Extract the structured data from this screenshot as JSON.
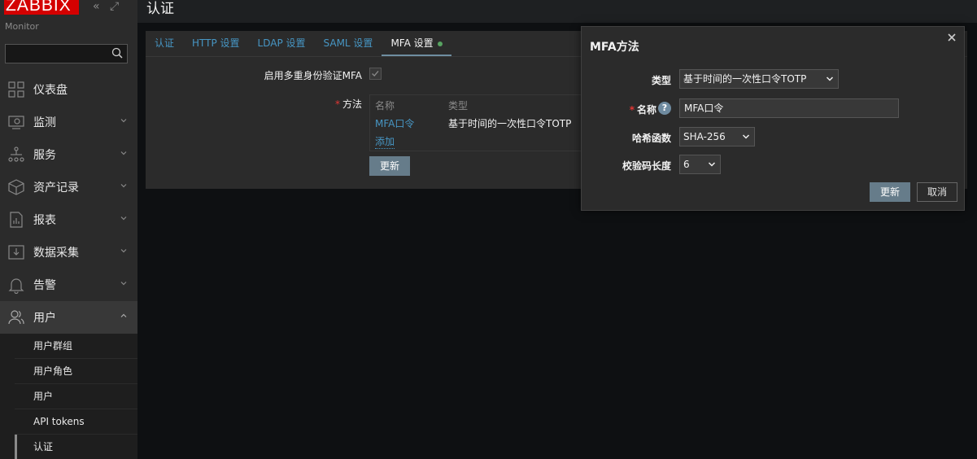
{
  "sidebar": {
    "logo": "ZABBIX",
    "server_name": "Monitor",
    "search_placeholder": "",
    "menu": [
      {
        "label": "仪表盘",
        "icon": "dashboard-icon"
      },
      {
        "label": "监测",
        "icon": "monitoring-icon"
      },
      {
        "label": "服务",
        "icon": "services-icon"
      },
      {
        "label": "资产记录",
        "icon": "inventory-icon"
      },
      {
        "label": "报表",
        "icon": "reports-icon"
      },
      {
        "label": "数据采集",
        "icon": "data-collection-icon"
      },
      {
        "label": "告警",
        "icon": "alerts-icon"
      },
      {
        "label": "用户",
        "icon": "users-icon"
      }
    ],
    "submenu": [
      "用户群组",
      "用户角色",
      "用户",
      "API tokens",
      "认证"
    ]
  },
  "page": {
    "title": "认证",
    "tabs": [
      "认证",
      "HTTP 设置",
      "LDAP 设置",
      "SAML 设置",
      "MFA 设置"
    ],
    "active_tab": "MFA 设置"
  },
  "form": {
    "enable_mfa_label": "启用多重身份验证MFA",
    "methods_label": "方法",
    "table": {
      "col_name": "名称",
      "col_type": "类型",
      "rows": [
        {
          "name": "MFA口令",
          "type": "基于时间的一次性口令TOTP"
        }
      ],
      "add_label": "添加"
    },
    "update_label": "更新"
  },
  "dialog": {
    "title": "MFA方法",
    "type_label": "类型",
    "type_value": "基于时间的一次性口令TOTP",
    "name_label": "名称",
    "name_value": "MFA口令",
    "hash_label": "哈希函数",
    "hash_value": "SHA-256",
    "code_length_label": "校验码长度",
    "code_length_value": "6",
    "update_label": "更新",
    "cancel_label": "取消"
  },
  "colors": {
    "accent": "#4796c4",
    "brand": "#d40000",
    "primary_button": "#667c8a",
    "status_ok": "#57a361"
  }
}
